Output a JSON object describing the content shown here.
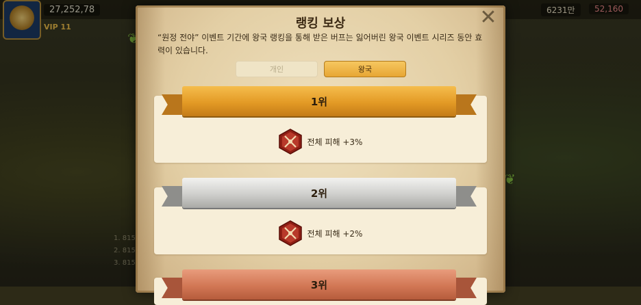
{
  "hud": {
    "power": "27,252,78",
    "vip": "VIP 11",
    "food": "6231만",
    "gems": "52,160"
  },
  "modal": {
    "title": "랭킹 보상",
    "description": "“원정 전야” 이벤트 기간에 왕국 랭킹을 통해 받은 버프는 잃어버린 왕국 이벤트 시리즈 동안 효력이 있습니다.",
    "tabs": [
      {
        "label": "개인",
        "active": false
      },
      {
        "label": "왕국",
        "active": true
      }
    ],
    "ranks": [
      {
        "label": "1위",
        "ribbon_color": "#e39a25",
        "reward": "전체 피해 +3%"
      },
      {
        "label": "2위",
        "ribbon_color": "#cfcfcc",
        "reward": "전체 피해 +2%"
      },
      {
        "label": "3위",
        "ribbon_color": "#d27755",
        "reward": ""
      }
    ],
    "reward_icon": "crossed-swords-icon"
  },
  "background_list": [
    "1. 815",
    "2. 815",
    "3. 815"
  ]
}
